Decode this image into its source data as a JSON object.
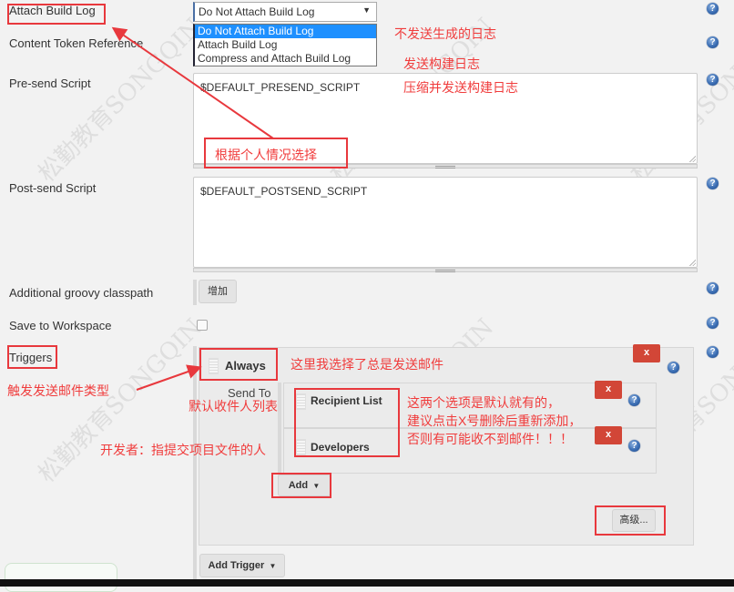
{
  "form": {
    "attach_build_log": {
      "label": "Attach Build Log",
      "selected": "Do Not Attach Build Log",
      "options": [
        "Do Not Attach Build Log",
        "Attach Build Log",
        "Compress and Attach Build Log"
      ]
    },
    "content_token_reference": {
      "label": "Content Token Reference"
    },
    "pre_send_script": {
      "label": "Pre-send Script",
      "value": "$DEFAULT_PRESEND_SCRIPT"
    },
    "post_send_script": {
      "label": "Post-send Script",
      "value": "$DEFAULT_POSTSEND_SCRIPT"
    },
    "additional_groovy_classpath": {
      "label": "Additional groovy classpath",
      "button": "增加"
    },
    "save_to_workspace": {
      "label": "Save to Workspace",
      "checked": false
    },
    "triggers": {
      "label": "Triggers",
      "trigger_name": "Always",
      "send_to_label": "Send To",
      "recipients": [
        "Recipient List",
        "Developers"
      ],
      "add_button": "Add",
      "advanced_button": "高级...",
      "add_trigger_button": "Add Trigger",
      "delete_label": "x"
    },
    "help_icon_glyph": "?"
  },
  "annotations": {
    "opt1": "不发送生成的日志",
    "opt2": "发送构建日志",
    "opt3": "压缩并发送构建日志",
    "choose": "根据个人情况选择",
    "trigger_type": "触发发送邮件类型",
    "always_note": "这里我选择了总是发送邮件",
    "recipient_note": "默认收件人列表",
    "developers_note": "开发者：指提交项目文件的人",
    "default_note_1": "这两个选项是默认就有的，",
    "default_note_2": "建议点击X号删除后重新添加，",
    "default_note_3": "否则有可能收不到邮件！！！"
  },
  "watermark": {
    "text_cn": "松勤教育",
    "text_en": "SONGQIN"
  },
  "colors": {
    "annotation": "#f03c3c",
    "delete": "#d24637",
    "selected_option": "#1e90ff"
  }
}
